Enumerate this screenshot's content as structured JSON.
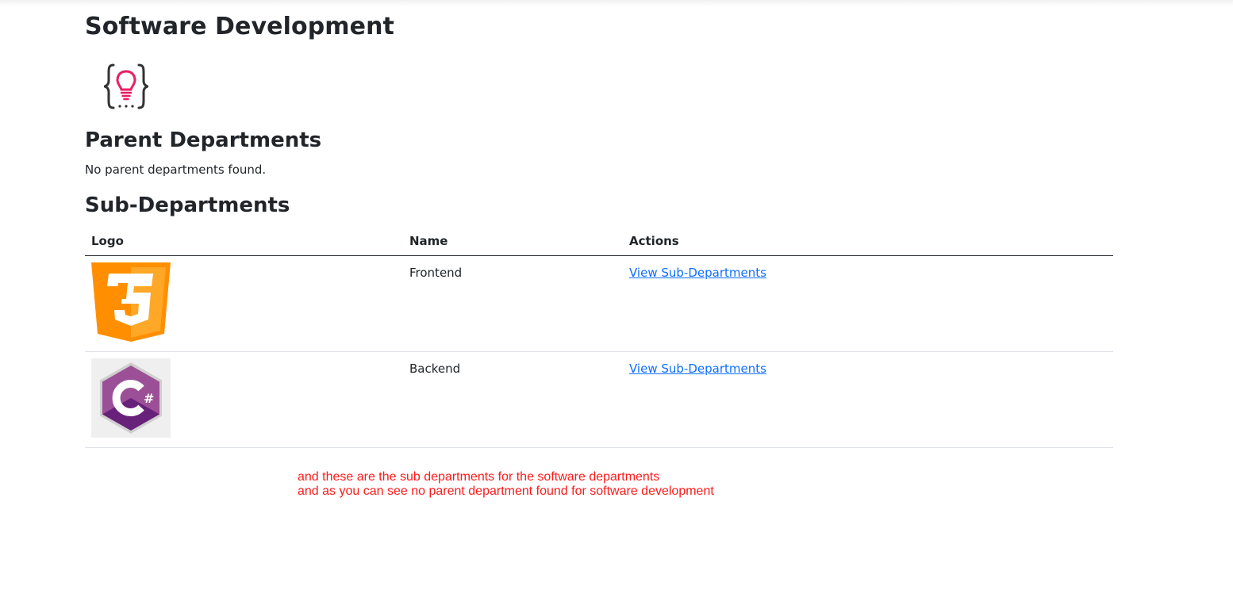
{
  "page": {
    "title": "Software Development",
    "logo_icon": "lightbulb-braces-icon"
  },
  "parent_departments": {
    "heading": "Parent Departments",
    "empty_message": "No parent departments found."
  },
  "sub_departments": {
    "heading": "Sub-Departments",
    "columns": [
      "Logo",
      "Name",
      "Actions"
    ],
    "rows": [
      {
        "logo_icon": "css3-icon",
        "name": "Frontend",
        "action_label": "View Sub-Departments"
      },
      {
        "logo_icon": "csharp-icon",
        "name": "Backend",
        "action_label": "View Sub-Departments"
      }
    ]
  },
  "annotation": {
    "line1": "and these are the sub departments for the software departments",
    "line2": "and as you can see no parent department found for software development"
  },
  "colors": {
    "link": "#0d6efd",
    "annotation": "#ff1a1a",
    "css3": "#ff9800",
    "csharp": "#8e44ad",
    "accent_logo": "#e91e63"
  }
}
